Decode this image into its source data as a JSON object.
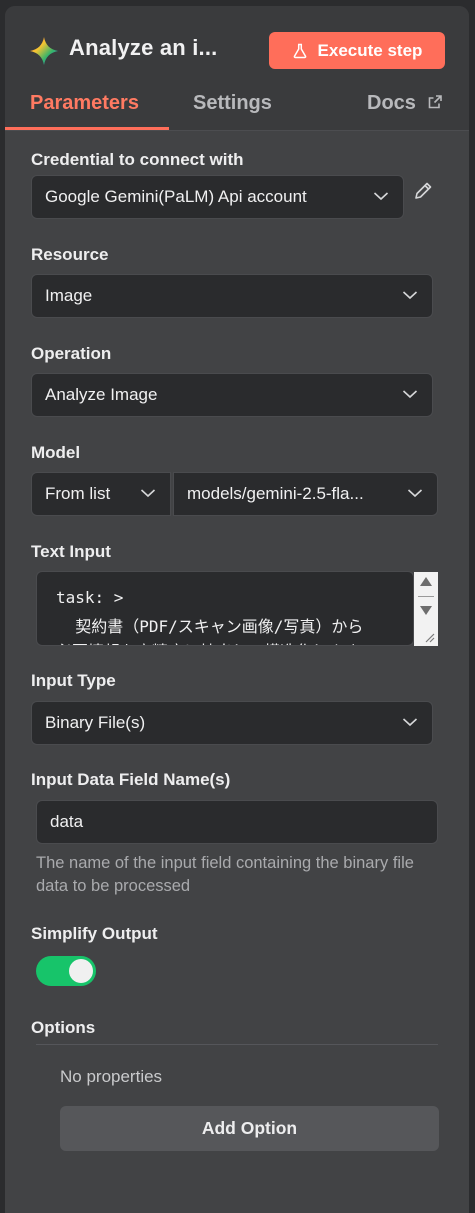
{
  "header": {
    "title": "Analyze an i...",
    "execute_label": "Execute step",
    "logo_icon": "gemini-sparkle-icon"
  },
  "tabs": [
    {
      "label": "Parameters",
      "active": true
    },
    {
      "label": "Settings",
      "active": false
    },
    {
      "label": "Docs",
      "active": false
    }
  ],
  "credential": {
    "label": "Credential to connect with",
    "value": "Google Gemini(PaLM) Api account"
  },
  "resource": {
    "label": "Resource",
    "value": "Image"
  },
  "operation": {
    "label": "Operation",
    "value": "Analyze Image"
  },
  "model": {
    "label": "Model",
    "mode": "From list",
    "value": "models/gemini-2.5-fla..."
  },
  "text_input": {
    "label": "Text Input",
    "lines": [
      "task: >",
      "  契約書（PDF/スキャン画像/写真）から",
      "必要情報を高精度に抽出し、構造化します"
    ]
  },
  "input_type": {
    "label": "Input Type",
    "value": "Binary File(s)"
  },
  "input_field": {
    "label": "Input Data Field Name(s)",
    "value": "data",
    "hint": "The name of the input field containing the binary file data to be processed"
  },
  "simplify": {
    "label": "Simplify Output",
    "enabled": true
  },
  "options": {
    "label": "Options",
    "empty_text": "No properties",
    "add_label": "Add Option"
  },
  "colors": {
    "accent": "#ff6e5a",
    "toggle_on": "#17c46a",
    "panel": "#424345"
  }
}
